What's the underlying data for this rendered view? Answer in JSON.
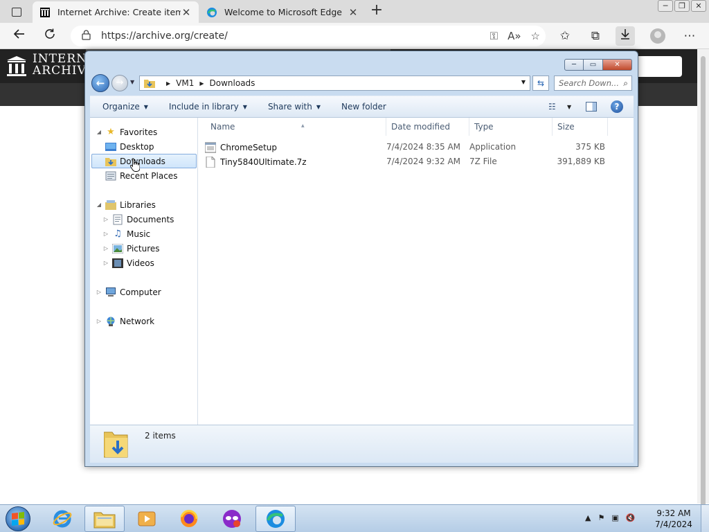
{
  "browser": {
    "tabs": [
      {
        "title": "Internet Archive: Create item",
        "close": "✕",
        "favicon": "archive-favicon-icon",
        "active": true
      },
      {
        "title": "Welcome to Microsoft Edge",
        "close": "✕",
        "favicon": "edge-favicon-icon",
        "active": false
      }
    ],
    "new_tab": "+",
    "url": "https://archive.org/create/",
    "window_buttons": [
      "─",
      "❐",
      "✕"
    ]
  },
  "page": {
    "logo_line1": "INTERN",
    "logo_line2": "ARCHIVE"
  },
  "explorer": {
    "controls": {
      "minimize": "─",
      "maximize": "▭",
      "close": "✕"
    },
    "breadcrumb": [
      "VM1",
      "Downloads"
    ],
    "search_placeholder": "Search Down...",
    "toolbar": [
      {
        "label": "Organize",
        "dropdown": true
      },
      {
        "label": "Include in library",
        "dropdown": true
      },
      {
        "label": "Share with",
        "dropdown": true
      },
      {
        "label": "New folder",
        "dropdown": false
      }
    ],
    "nav": {
      "favorites": "Favorites",
      "desktop": "Desktop",
      "downloads": "Downloads",
      "recent": "Recent Places",
      "libraries": "Libraries",
      "documents": "Documents",
      "music": "Music",
      "pictures": "Pictures",
      "videos": "Videos",
      "computer": "Computer",
      "network": "Network"
    },
    "columns": {
      "name": "Name",
      "date": "Date modified",
      "type": "Type",
      "size": "Size"
    },
    "files": [
      {
        "name": "ChromeSetup",
        "date": "7/4/2024 8:35 AM",
        "type": "Application",
        "size": "375 KB"
      },
      {
        "name": "Tiny5840Ultimate.7z",
        "date": "7/4/2024 9:32 AM",
        "type": "7Z File",
        "size": "391,889 KB"
      }
    ],
    "item_count": "2 items"
  },
  "taskbar": {
    "time": "9:32 AM",
    "date": "7/4/2024"
  },
  "colors": {
    "edge_chrome": "#f5f5f5",
    "explorer_frame": "#c9dcf0",
    "selection": "#cfe5fb",
    "taskbar": "#c4d8ec"
  }
}
